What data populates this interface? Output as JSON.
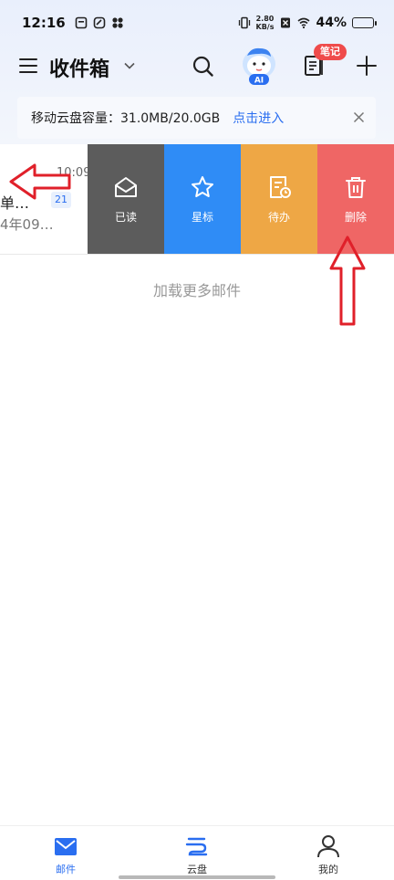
{
  "status_bar": {
    "time": "12:16",
    "net_speed_value": "2.80",
    "net_speed_unit": "KB/s",
    "battery_percent": "44%",
    "battery_level": 0.44
  },
  "header": {
    "title": "收件箱",
    "ai_label": "AI",
    "notes_badge": "笔记"
  },
  "banner": {
    "text": "移动云盘容量：31.0MB/20.0GB",
    "link": "点击进入"
  },
  "email": {
    "time_fragment": "10:09",
    "subject_fragment": "单…",
    "count": "21",
    "snippet_fragment": "4年09…"
  },
  "swipe_actions": [
    {
      "label": "已读",
      "icon": "envelope-open-icon",
      "color": "#5c5c5c"
    },
    {
      "label": "星标",
      "icon": "star-icon",
      "color": "#2f8cf6"
    },
    {
      "label": "待办",
      "icon": "todo-icon",
      "color": "#eea745"
    },
    {
      "label": "删除",
      "icon": "trash-icon",
      "color": "#ef6665"
    }
  ],
  "load_more": "加载更多邮件",
  "bottom_nav": [
    {
      "label": "邮件",
      "icon": "mail-icon",
      "active": true
    },
    {
      "label": "云盘",
      "icon": "cloud-icon",
      "active": false
    },
    {
      "label": "我的",
      "icon": "profile-icon",
      "active": false
    }
  ],
  "colors": {
    "accent": "#2a6ef0",
    "annotation": "#e0202a"
  }
}
